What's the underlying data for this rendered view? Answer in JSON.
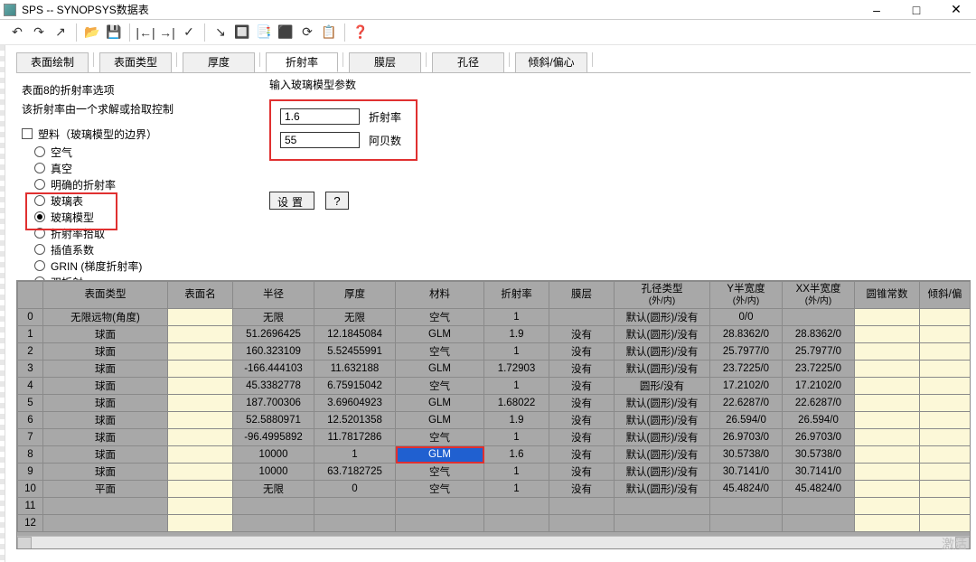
{
  "window": {
    "title": "SPS -- SYNOPSYS数据表",
    "minimize": "–",
    "maximize": "□",
    "close": "✕"
  },
  "toolbar_icons": [
    "↶",
    "↷",
    "↗",
    "📂",
    "💾",
    "|←|",
    "→|",
    "✓",
    "↘",
    "🔲",
    "📑",
    "⬛",
    "⟳",
    "📋",
    "❓"
  ],
  "tabs": [
    "表面绘制",
    "表面类型",
    "厚度",
    "折射率",
    "膜层",
    "孔径",
    "倾斜/偏心"
  ],
  "active_tab": "折射率",
  "options": {
    "title": "表面8的折射率选项",
    "subtitle": "该折射率由一个求解或拾取控制",
    "plastic_label": "塑料（玻璃模型的边界）",
    "radios": [
      "空气",
      "真空",
      "明确的折射率",
      "玻璃表",
      "玻璃模型",
      "折射率拾取",
      "插值系数",
      "GRIN (梯度折射率)",
      "双折射"
    ],
    "selected_radio": "玻璃模型"
  },
  "rhs": {
    "title": "输入玻璃模型参数",
    "index_label": "折射率",
    "index_value": "1.6",
    "abbe_label": "阿贝数",
    "abbe_value": "55",
    "set_btn": "设置",
    "help_btn": "?"
  },
  "grid": {
    "headers": [
      {
        "label": ""
      },
      {
        "label": "表面类型"
      },
      {
        "label": "表面名"
      },
      {
        "label": "半径"
      },
      {
        "label": "厚度"
      },
      {
        "label": "材料"
      },
      {
        "label": "折射率"
      },
      {
        "label": "膜层"
      },
      {
        "label": "孔径类型",
        "sub": "(外/内)"
      },
      {
        "label": "Y半宽度",
        "sub": "(外/内)"
      },
      {
        "label": "XX半宽度",
        "sub": "(外/内)"
      },
      {
        "label": "圆锥常数"
      },
      {
        "label": "倾斜/偏"
      }
    ],
    "rows": [
      {
        "n": "0",
        "type": "无限远物(角度)",
        "name": "",
        "r": "无限",
        "t": "无限",
        "mat": "空气",
        "idx": "1",
        "coat": "",
        "ap": "默认(圆形)/没有",
        "yw": "0/0",
        "xw": "",
        "conic": "",
        "tilt": ""
      },
      {
        "n": "1",
        "type": "球面",
        "name": "",
        "r": "51.2696425",
        "t": "12.1845084",
        "mat": "GLM",
        "idx": "1.9",
        "coat": "没有",
        "ap": "默认(圆形)/没有",
        "yw": "28.8362/0",
        "xw": "28.8362/0",
        "conic": "",
        "tilt": ""
      },
      {
        "n": "2",
        "type": "球面",
        "name": "",
        "r": "160.323109",
        "t": "5.52455991",
        "mat": "空气",
        "idx": "1",
        "coat": "没有",
        "ap": "默认(圆形)/没有",
        "yw": "25.7977/0",
        "xw": "25.7977/0",
        "conic": "",
        "tilt": ""
      },
      {
        "n": "3",
        "type": "球面",
        "name": "",
        "r": "-166.444103",
        "t": "11.632188",
        "mat": "GLM",
        "idx": "1.72903",
        "coat": "没有",
        "ap": "默认(圆形)/没有",
        "yw": "23.7225/0",
        "xw": "23.7225/0",
        "conic": "",
        "tilt": ""
      },
      {
        "n": "4",
        "type": "球面",
        "name": "",
        "r": "45.3382778",
        "t": "6.75915042",
        "mat": "空气",
        "idx": "1",
        "coat": "没有",
        "ap": "圆形/没有",
        "yw": "17.2102/0",
        "xw": "17.2102/0",
        "conic": "",
        "tilt": ""
      },
      {
        "n": "5",
        "type": "球面",
        "name": "",
        "r": "187.700306",
        "t": "3.69604923",
        "mat": "GLM",
        "idx": "1.68022",
        "coat": "没有",
        "ap": "默认(圆形)/没有",
        "yw": "22.6287/0",
        "xw": "22.6287/0",
        "conic": "",
        "tilt": ""
      },
      {
        "n": "6",
        "type": "球面",
        "name": "",
        "r": "52.5880971",
        "t": "12.5201358",
        "mat": "GLM",
        "idx": "1.9",
        "coat": "没有",
        "ap": "默认(圆形)/没有",
        "yw": "26.594/0",
        "xw": "26.594/0",
        "conic": "",
        "tilt": ""
      },
      {
        "n": "7",
        "type": "球面",
        "name": "",
        "r": "-96.4995892",
        "t": "11.7817286",
        "mat": "空气",
        "idx": "1",
        "coat": "没有",
        "ap": "默认(圆形)/没有",
        "yw": "26.9703/0",
        "xw": "26.9703/0",
        "conic": "",
        "tilt": ""
      },
      {
        "n": "8",
        "type": "球面",
        "name": "",
        "r": "10000",
        "t": "1",
        "mat": "GLM",
        "idx": "1.6",
        "coat": "没有",
        "ap": "默认(圆形)/没有",
        "yw": "30.5738/0",
        "xw": "30.5738/0",
        "conic": "",
        "tilt": "",
        "sel": true
      },
      {
        "n": "9",
        "type": "球面",
        "name": "",
        "r": "10000",
        "t": "63.7182725",
        "mat": "空气",
        "idx": "1",
        "coat": "没有",
        "ap": "默认(圆形)/没有",
        "yw": "30.7141/0",
        "xw": "30.7141/0",
        "conic": "",
        "tilt": ""
      },
      {
        "n": "10",
        "type": "平面",
        "name": "",
        "r": "无限",
        "t": "0",
        "mat": "空气",
        "idx": "1",
        "coat": "没有",
        "ap": "默认(圆形)/没有",
        "yw": "45.4824/0",
        "xw": "45.4824/0",
        "conic": "",
        "tilt": ""
      },
      {
        "n": "11",
        "type": "",
        "name": "",
        "r": "",
        "t": "",
        "mat": "",
        "idx": "",
        "coat": "",
        "ap": "",
        "yw": "",
        "xw": "",
        "conic": "",
        "tilt": ""
      },
      {
        "n": "12",
        "type": "",
        "name": "",
        "r": "",
        "t": "",
        "mat": "",
        "idx": "",
        "coat": "",
        "ap": "",
        "yw": "",
        "xw": "",
        "conic": "",
        "tilt": ""
      }
    ]
  },
  "watermark": "激活"
}
